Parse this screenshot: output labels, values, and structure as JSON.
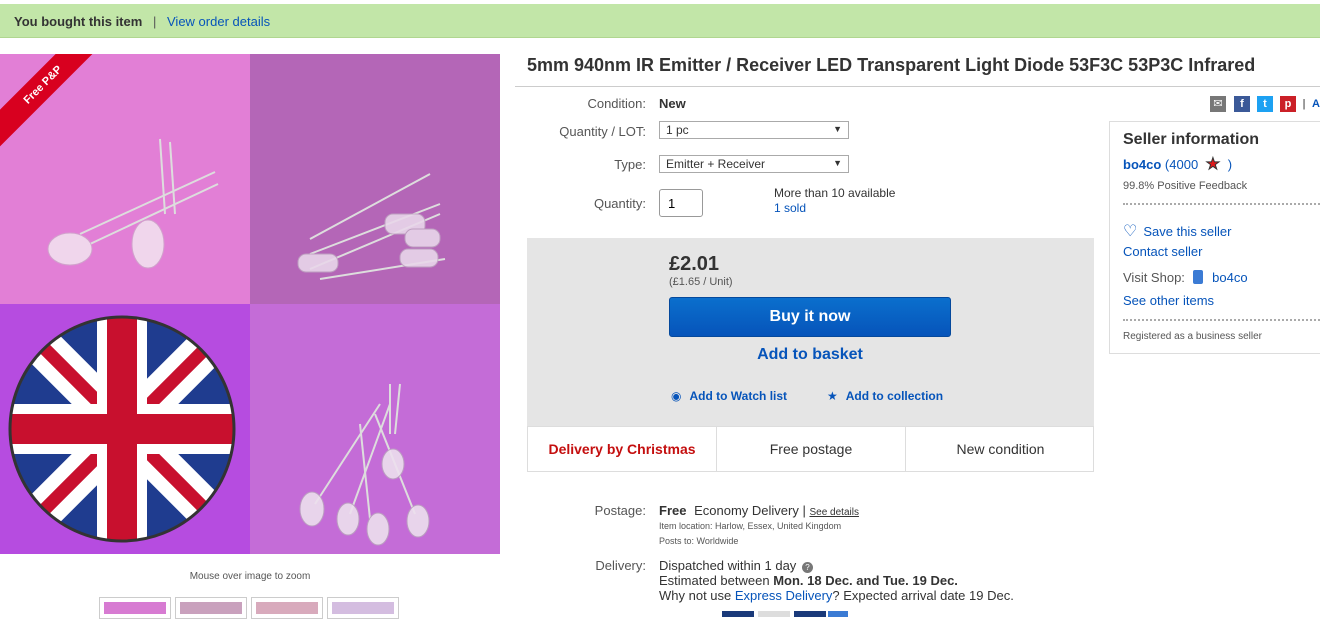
{
  "notice": {
    "bought_text": "You bought this item",
    "separator": "|",
    "view_order_link": "View order details"
  },
  "gallery": {
    "ribbon": "Free P&P",
    "zoom_hint": "Mouse over image to zoom"
  },
  "listing": {
    "title": "5mm 940nm IR Emitter / Receiver LED Transparent Light Diode 53F3C 53P3C Infrared",
    "condition_label": "Condition:",
    "condition_value": "New",
    "lot_label": "Quantity / LOT:",
    "lot_selected": "1 pc",
    "type_label": "Type:",
    "type_selected": "Emitter + Receiver",
    "quantity_label": "Quantity:",
    "quantity_value": "1",
    "availability": "More than 10 available",
    "sold": "1 sold"
  },
  "buy": {
    "price": "£2.01",
    "unit_price": "(£1.65 / Unit)",
    "buy_now": "Buy it now",
    "add_basket": "Add to basket",
    "watch": "Add to Watch list",
    "collection": "Add to collection"
  },
  "features": {
    "christmas": "Delivery by Christmas",
    "free_postage": "Free postage",
    "new_condition": "New condition"
  },
  "shipping": {
    "postage_label": "Postage:",
    "postage_free": "Free",
    "postage_type": "Economy Delivery |",
    "see_details": "See details",
    "item_location": "Item location:  Harlow, Essex, United Kingdom",
    "posts_to": "Posts to:  Worldwide",
    "delivery_label": "Delivery:",
    "dispatched": "Dispatched within 1 day",
    "estimate_prefix": "Estimated between",
    "estimate_dates": "Mon. 18 Dec. and Tue. 19 Dec.",
    "why_prefix": "Why not use",
    "express_link": "Express Delivery",
    "why_suffix": "? Expected arrival date 19 Dec."
  },
  "social": {
    "divider": "|",
    "more": "A"
  },
  "seller": {
    "heading": "Seller information",
    "username": "bo4co",
    "feedback_score": "(4000",
    "feedback_close": ")",
    "positive": "99.8% Positive Feedback",
    "save_seller": "Save this seller",
    "contact": "Contact seller",
    "visit_shop": "Visit Shop:",
    "shop_name": "bo4co",
    "see_items": "See other items",
    "registered": "Registered as a business seller"
  },
  "colors": {
    "accent_blue": "#0654ba",
    "notice_green": "#c2e6a8",
    "christmas_red": "#c40e0e"
  }
}
